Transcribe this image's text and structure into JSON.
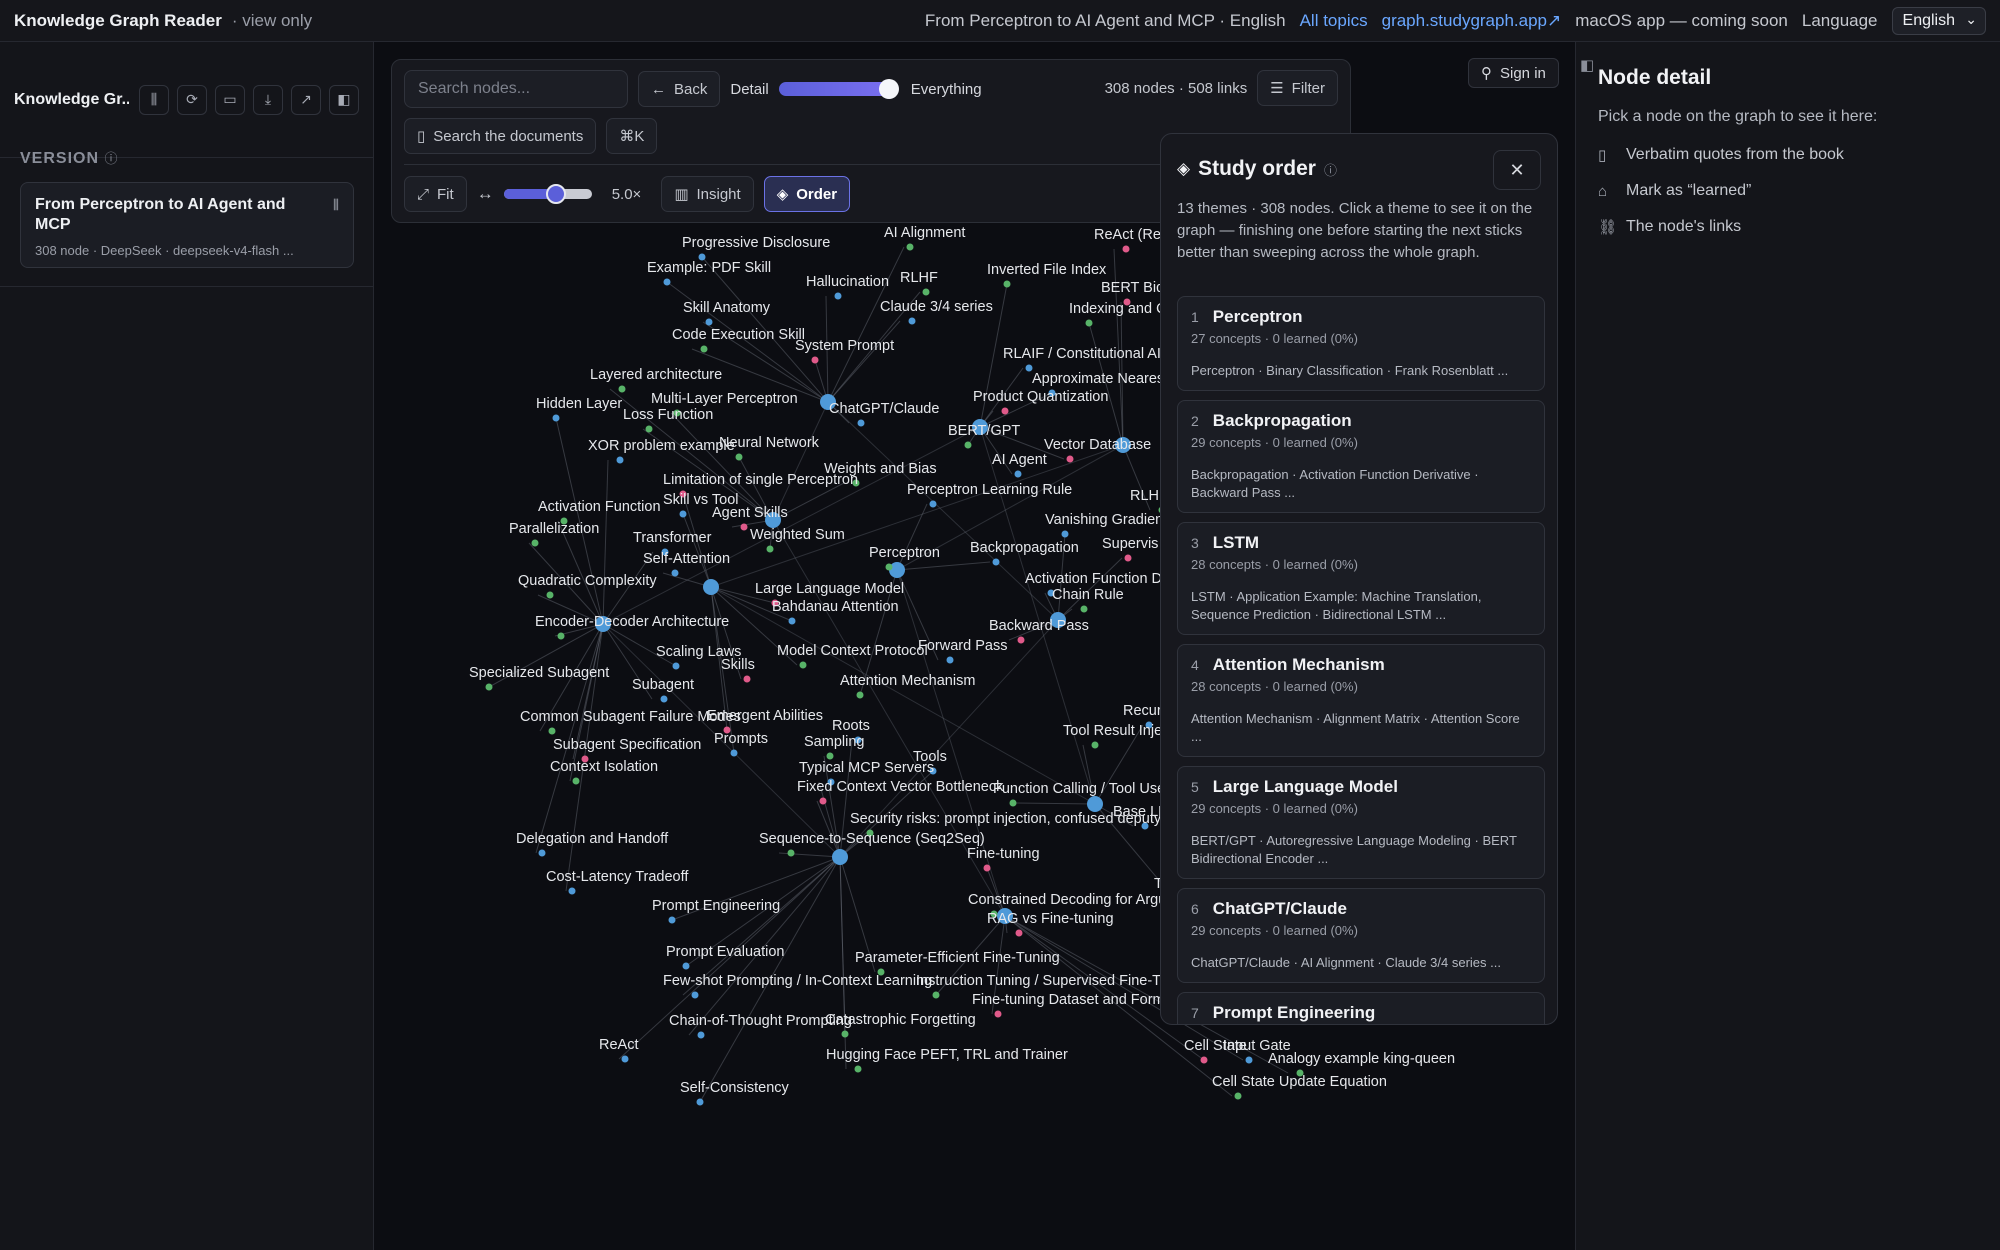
{
  "topbar": {
    "brand": "Knowledge Graph Reader",
    "view_only": "· view only",
    "crumb": "From Perceptron to AI Agent and MCP · English",
    "all_topics": "All topics",
    "site_link": "graph.studygraph.app↗",
    "mac_app": "macOS app — coming soon",
    "language_label": "Language",
    "language_value": "English"
  },
  "left": {
    "title": "Knowledge Gr...",
    "section": "VERSION",
    "version_title": "From Perceptron to AI Agent and MCP",
    "version_meta": "308 node · DeepSeek · deepseek-v4-flash ..."
  },
  "toolbar": {
    "search_placeholder": "Search nodes...",
    "back": "Back",
    "detail_label": "Detail",
    "detail_value": "Everything",
    "detail_level": 1.0,
    "counts": "308 nodes · 508 links",
    "filter": "Filter",
    "search_docs": "Search the documents",
    "shortcut": "⌘K",
    "fit": "Fit",
    "zoom": "5.0×",
    "insight": "Insight",
    "order": "Order"
  },
  "signin": "Sign in",
  "study": {
    "title": "Study order",
    "desc": "13 themes · 308 nodes. Click a theme to see it on the graph — finishing one before starting the next sticks better than sweeping across the whole graph.",
    "themes": [
      {
        "num": "1",
        "name": "Perceptron",
        "stat": "27 concepts · 0 learned (0%)",
        "tags": "Perceptron · Binary Classification · Frank Rosenblatt ..."
      },
      {
        "num": "2",
        "name": "Backpropagation",
        "stat": "29 concepts · 0 learned (0%)",
        "tags": "Backpropagation · Activation Function Derivative · Backward Pass ..."
      },
      {
        "num": "3",
        "name": "LSTM",
        "stat": "28 concepts · 0 learned (0%)",
        "tags": "LSTM · Application Example: Machine Translation, Sequence Prediction · Bidirectional LSTM ..."
      },
      {
        "num": "4",
        "name": "Attention Mechanism",
        "stat": "28 concepts · 0 learned (0%)",
        "tags": "Attention Mechanism · Alignment Matrix · Attention Score ..."
      },
      {
        "num": "5",
        "name": "Large Language Model",
        "stat": "29 concepts · 0 learned (0%)",
        "tags": "BERT/GPT · Autoregressive Language Modeling · BERT Bidirectional Encoder ..."
      },
      {
        "num": "6",
        "name": "ChatGPT/Claude",
        "stat": "29 concepts · 0 learned (0%)",
        "tags": "ChatGPT/Claude · AI Alignment · Claude 3/4 series ..."
      },
      {
        "num": "7",
        "name": "Prompt Engineering",
        "stat": "",
        "tags": ""
      }
    ]
  },
  "right": {
    "title": "Node detail",
    "subtitle": "Pick a node on the graph to see it here:",
    "items": [
      "Verbatim quotes from the book",
      "Mark as “learned”",
      "The node's links"
    ]
  },
  "graph_labels": [
    "Progressive Disclosure",
    "AI Alignment",
    "ReAct (Reason + Act)",
    "Example: PDF Skill",
    "RLHF",
    "Hallucination",
    "Inverted File Index",
    "BERT Bidirectional Encoder",
    "Claude 3/4 series",
    "Indexing and Query Pipeline",
    "Skill Anatomy",
    "Code Execution Skill",
    "System Prompt",
    "RLAIF / Constitutional AI",
    "Layered architecture",
    "Approximate Nearest Neighbor Search",
    "Multi-Layer Perceptron",
    "Product Quantization",
    "Hidden Layer",
    "Loss Function",
    "ChatGPT/Claude",
    "BERT/GPT",
    "Vector Database",
    "XOR problem example",
    "Neural Network",
    "AI Agent",
    "Weights and Bias",
    "Limitation of single Perceptron",
    "Perceptron Learning Rule",
    "RLHF / Instruct",
    "Skill vs Tool",
    "Activation Function",
    "Agent Skills",
    "Vanishing Gradient Problem",
    "Parallelization",
    "Transformer",
    "Weighted Sum",
    "Supervis",
    "Self-Attention",
    "Perceptron",
    "Backpropagation",
    "Quadratic Complexity",
    "Large Language Model",
    "Activation Function Derivative",
    "Chain Rule",
    "Bahdanau Attention",
    "Encoder-Decoder Architecture",
    "Backward Pass",
    "Scaling Laws",
    "Model Context Protocol",
    "Forward Pass",
    "Specialized Subagent",
    "Skills",
    "Subagent",
    "Attention Mechanism",
    "Recurrent",
    "Common Subagent Failure Modes",
    "Emergent Abilities",
    "Roots",
    "Tool Result Injection",
    "Prompts",
    "Sampling",
    "Subagent Specification",
    "Tools",
    "Context Isolation",
    "Typical MCP Servers",
    "Function Calling / Tool Use",
    "Fixed Context Vector Bottleneck",
    "Base LLM",
    "Security risks: prompt injection, confused deputy, tool poisoning",
    "Delegation and Handoff",
    "Sequence-to-Sequence (Seq2Seq)",
    "Fine-tuning",
    "Cost-Latency Tradeoff",
    "Tool Declaration in Con",
    "Prompt Engineering",
    "Constrained Decoding for Arguments",
    "RAG vs Fine-tuning",
    "Prompt Evaluation",
    "Parameter-Efficient Fine-Tuning",
    "Few-shot Prompting / In-Context Learning",
    "Instruction Tuning / Supervised Fine-Tuning",
    "Fine-tuning Dataset and Formats",
    "Chain-of-Thought Prompting",
    "Catastrophic Forgetting",
    "ReAct",
    "Hugging Face PEFT, TRL and Trainer",
    "Cell State",
    "Input Gate",
    "Analogy example king-queen",
    "Self-Consistency",
    "Cell State Update Equation"
  ]
}
